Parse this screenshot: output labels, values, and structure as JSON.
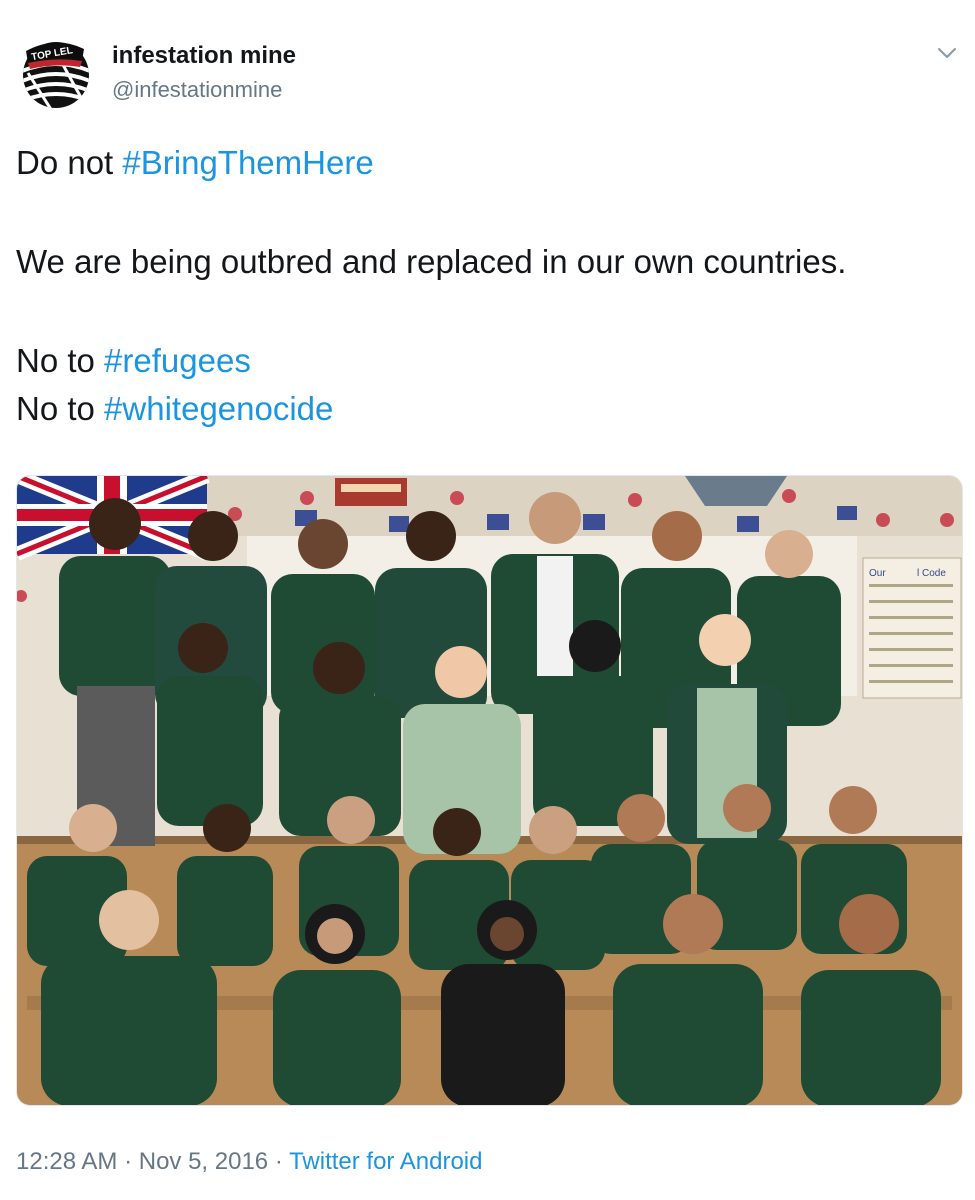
{
  "tweet": {
    "display_name": "infestation mine",
    "handle": "@infestationmine",
    "avatar_text": "TOP LEL",
    "line1_prefix": "Do not ",
    "line1_hashtag": "#BringThemHere",
    "line2": "We are being outbred and replaced in our own countries.",
    "line3_prefix": "No to ",
    "line3_hashtag": "#refugees",
    "line4_prefix": "No to ",
    "line4_hashtag": "#whitegenocide",
    "time": "12:28 AM",
    "separator": " · ",
    "date": "Nov 5, 2016",
    "source": "Twitter for Android",
    "photo_sign_text": "Our",
    "photo_sign_text2": "l Code"
  },
  "colors": {
    "link": "#1b95e0",
    "text": "#14171a",
    "muted": "#657786",
    "uniform": "#1f4a34"
  },
  "icons": {
    "menu": "chevron-down-icon"
  }
}
